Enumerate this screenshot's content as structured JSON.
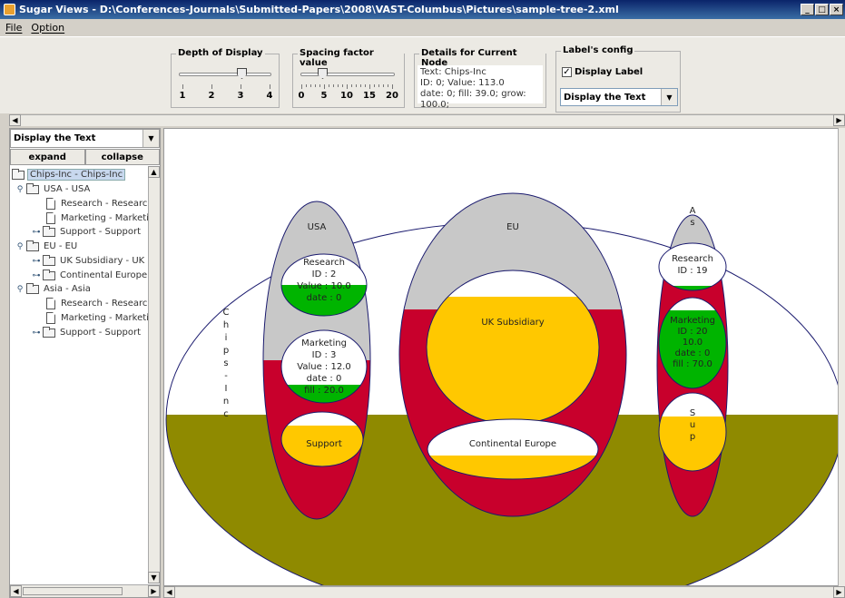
{
  "window": {
    "title": "Sugar Views - D:\\Conferences-Journals\\Submitted-Papers\\2008\\VAST-Columbus\\Pictures\\sample-tree-2.xml",
    "minimize": "_",
    "maximize": "□",
    "close": "×"
  },
  "menu": {
    "items": [
      "File",
      "Option"
    ]
  },
  "depth": {
    "title": "Depth of Display",
    "ticks": [
      "1",
      "2",
      "3",
      "4"
    ],
    "value": 3
  },
  "spacing": {
    "title": "Spacing factor value",
    "ticks": [
      "0",
      "5",
      "10",
      "15",
      "20"
    ],
    "value": 3
  },
  "details": {
    "title": "Details for Current Node",
    "line1": "Text: Chips-Inc",
    "line2": "ID: 0; Value: 113.0",
    "line3": "date: 0; fill: 39.0; grow: 100.0;"
  },
  "label_config": {
    "title": "Label's config",
    "display_label": "Display Label",
    "checked_mark": "✓",
    "combo_value": "Display the Text"
  },
  "left_panel": {
    "combo_value": "Display the Text",
    "expand": "expand",
    "collapse": "collapse",
    "tree": [
      "Chips-Inc - Chips-Inc",
      "USA - USA",
      "Research - Research",
      "Marketing - Marketing",
      "Support - Support",
      "EU - EU",
      "UK Subsidiary - UK Su",
      "Continental Europe - C",
      "Asia - Asia",
      "Research - Research",
      "Marketing - Marketing",
      "Support - Support"
    ]
  },
  "canvas": {
    "root_label_chars": [
      "C",
      "h",
      "i",
      "p",
      "s",
      "-",
      "I",
      "n",
      "c"
    ],
    "usa": "USA",
    "eu": "EU",
    "asia_chars": [
      "A",
      "s"
    ],
    "usa_research": [
      "Research",
      "ID : 2",
      "Value : 10.0",
      "date : 0"
    ],
    "usa_marketing": [
      "Marketing",
      "ID : 3",
      "Value : 12.0",
      "date : 0",
      "fill : 20.0"
    ],
    "usa_support": "Support",
    "uk": "UK Subsidiary",
    "continental": "Continental Europe",
    "asia_research": [
      "Research",
      "ID : 19"
    ],
    "asia_marketing": [
      "Marketing",
      "ID : 20",
      "10.0",
      "date : 0",
      "fill : 70.0"
    ],
    "asia_support": [
      "S",
      "u",
      "p"
    ]
  },
  "colors": {
    "olive": "#8f8a00",
    "red": "#c8002c",
    "gray": "#c8c8c8",
    "yellow": "#ffc800",
    "green": "#00b400",
    "outline": "#1a1a6e"
  }
}
